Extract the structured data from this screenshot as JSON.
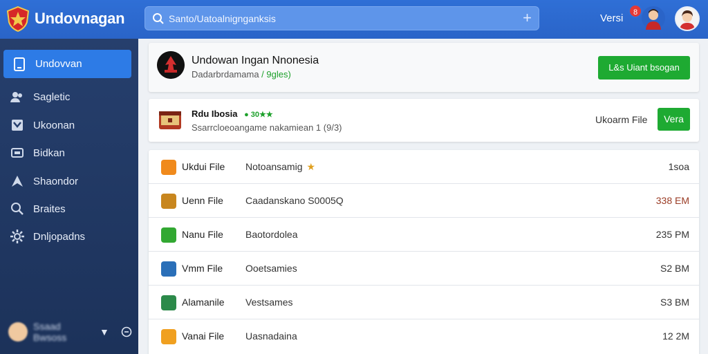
{
  "app": {
    "brand": "Undovnagan",
    "search_placeholder": "Santo/Uatoalnignganksis",
    "versi_label": "Versi",
    "notif_count": "8"
  },
  "sidebar": {
    "items": [
      {
        "label": "Undovvan",
        "icon": "tablet-icon",
        "active": true
      },
      {
        "label": "Sagletic",
        "icon": "users-icon"
      },
      {
        "label": "Ukoonan",
        "icon": "checkbox-icon"
      },
      {
        "label": "Bidkan",
        "icon": "box-icon"
      },
      {
        "label": "Shaondor",
        "icon": "send-icon"
      },
      {
        "label": "Braites",
        "icon": "search-icon"
      },
      {
        "label": "Dnljopadns",
        "icon": "gear-icon"
      }
    ],
    "footer": {
      "name": "Ssaad Bwsoss"
    }
  },
  "header": {
    "title": "Undowan Ingan Nnonesia",
    "subtitle": "Dadarbrdamama",
    "subtitle_accent": "/ 9gles)",
    "button": "L&s Uiant bsogan"
  },
  "featured": {
    "title": "Rdu Ibosia",
    "rating": "● 30★★",
    "subtitle": "Ssarrcloeoangame nakamiean 1 (9/3)",
    "link": "Ukoarm File",
    "button": "Vera"
  },
  "files": [
    {
      "name": "Ukdui File",
      "desc": "Notoansamig",
      "star": "★",
      "size": "1soa",
      "icon_color": "#f08a1c",
      "size_color": "#333333"
    },
    {
      "name": "Uenn File",
      "desc": "Caadanskano S0005Q",
      "star": "",
      "size": "338 EM",
      "icon_color": "#c8861e",
      "size_color": "#9a3b24"
    },
    {
      "name": "Nanu File",
      "desc": "Baotordolea",
      "star": "",
      "size": "235 PM",
      "icon_color": "#32a832",
      "size_color": "#333333"
    },
    {
      "name": "Vmm File",
      "desc": "Ooetsamies",
      "star": "",
      "size": "S2 BM",
      "icon_color": "#2a6fb8",
      "size_color": "#333333"
    },
    {
      "name": "Alamanile",
      "desc": "Vestsames",
      "star": "",
      "size": "S3 BM",
      "icon_color": "#2c8a4a",
      "size_color": "#333333"
    },
    {
      "name": "Vanai File",
      "desc": "Uasnadaina",
      "star": "",
      "size": "12 2M",
      "icon_color": "#f0a020",
      "size_color": "#333333"
    }
  ],
  "colors": {
    "topbar": "#2f6fd6",
    "sidebar": "#263f6d",
    "active_item": "#2d7be6",
    "green_button": "#1eaa32"
  }
}
